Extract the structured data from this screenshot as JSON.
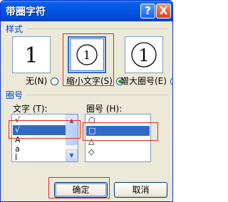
{
  "window": {
    "title": "带圈字符",
    "help_label": "?",
    "close_label": "X"
  },
  "style_group": {
    "title": "样式",
    "options": [
      {
        "label": "无",
        "hotkey": "(N)",
        "preview": "1",
        "selected": false
      },
      {
        "label": "缩小文字",
        "hotkey": "(S)",
        "preview": "①",
        "selected": true
      },
      {
        "label": "增大圈号",
        "hotkey": "(E)",
        "preview": "①",
        "selected": false
      }
    ]
  },
  "circle_group": {
    "title": "圈号",
    "text_label": "文字 (T):",
    "text_items": [
      "√",
      "√",
      "A",
      "a",
      "ǐ"
    ],
    "text_selected_index": 1,
    "shape_label": "圈号 (H):",
    "shape_items": [
      "○",
      "□",
      "△",
      "◇"
    ],
    "shape_selected_index": 1
  },
  "buttons": {
    "ok": "确定",
    "cancel": "取消"
  },
  "colors": {
    "selection": "#316ac5",
    "annotation": "#e8271b",
    "group_title": "#0046d5"
  }
}
